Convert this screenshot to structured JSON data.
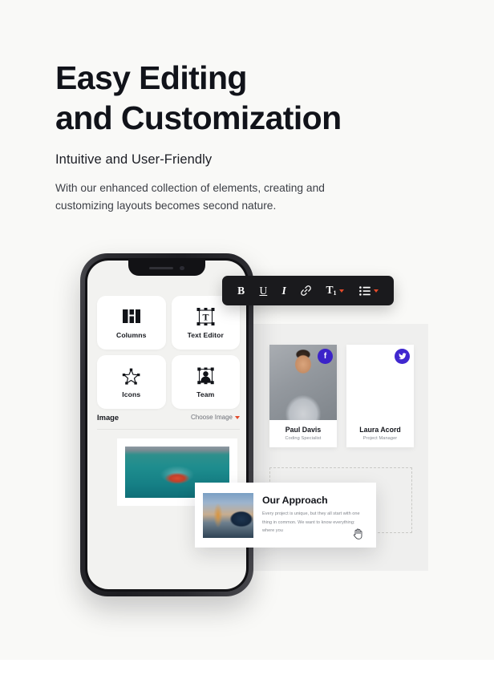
{
  "hero": {
    "headline_line1": "Easy Editing",
    "headline_line2": "and Customization",
    "subheading": "Intuitive and User-Friendly",
    "body": "With our enhanced collection of elements, creating and customizing layouts becomes second nature."
  },
  "phone": {
    "widgets": [
      {
        "label": "Columns",
        "icon": "columns-icon"
      },
      {
        "label": "Text Editor",
        "icon": "text-editor-icon"
      },
      {
        "label": "Icons",
        "icon": "star-icon"
      },
      {
        "label": "Team",
        "icon": "person-icon"
      }
    ],
    "image_section": {
      "label": "Image",
      "choose_label": "Choose Image",
      "caret": "▾"
    },
    "preview_photo_alt": "aerial view of container cargo ship at sea"
  },
  "toolbar": {
    "buttons": [
      {
        "name": "bold",
        "glyph": "B"
      },
      {
        "name": "underline",
        "glyph": "U"
      },
      {
        "name": "italic",
        "glyph": "I"
      },
      {
        "name": "link",
        "glyph": "🔗"
      },
      {
        "name": "text-size",
        "glyph": "T",
        "sub": "1",
        "has_caret": true
      },
      {
        "name": "list",
        "glyph": "☰",
        "has_caret": true
      }
    ]
  },
  "team": [
    {
      "name": "Paul Davis",
      "role": "Coding Specialist",
      "social": "facebook",
      "social_glyph": "f"
    },
    {
      "name": "Laura Acord",
      "role": "Project Manager",
      "social": "twitter",
      "social_glyph": "🐦"
    }
  ],
  "approach_card": {
    "title": "Our Approach",
    "text": "Every project is unique, but they all start with one thing in common. We want to know everything: where you",
    "thumb_alt": "harbour crane and ship hull at sunset",
    "cursor_glyph": "✋"
  },
  "colors": {
    "page_background": "#f9f9f7",
    "canvas_panel": "#efefee",
    "toolbar_background": "#1a1a1d",
    "accent_red": "#e34a2a",
    "social_purple": "#3b23c9",
    "heading_text": "#11131a"
  }
}
